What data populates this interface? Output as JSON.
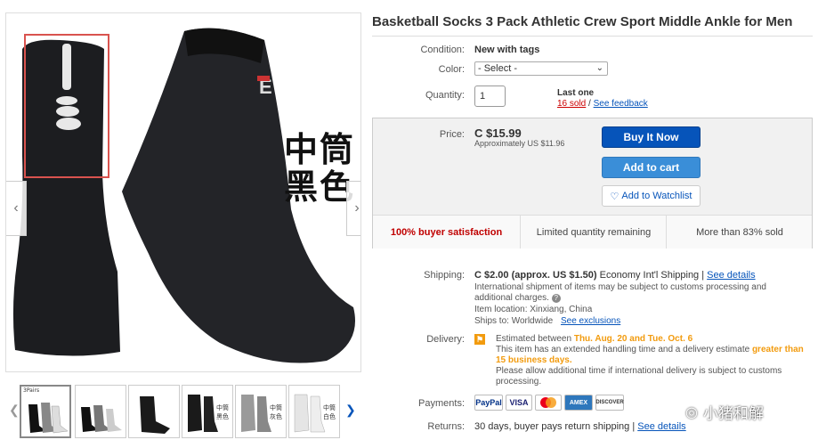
{
  "listing": {
    "title": "Basketball Socks 3 Pack Athletic Crew Sport Middle Ankle for Men",
    "gallery_overlay_text_line1": "中筒",
    "gallery_overlay_text_line2": "黑色",
    "thumbnail_labels": [
      "3Pairs",
      "中筒\n黑色",
      "中筒\n灰色",
      "中筒\n白色"
    ]
  },
  "details": {
    "condition_label": "Condition:",
    "condition_value": "New with tags",
    "color_label": "Color:",
    "color_select": "- Select -",
    "quantity_label": "Quantity:",
    "quantity_value": "1",
    "last_one": "Last one",
    "sold_link": "16 sold",
    "slash": "/",
    "feedback_link": "See feedback"
  },
  "price": {
    "label": "Price:",
    "value": "C $15.99",
    "approx": "Approximately US $11.96",
    "buy_now": "Buy It Now",
    "add_to_cart": "Add to cart",
    "add_to_watchlist": "Add to Watchlist",
    "satisfaction": "100% buyer satisfaction",
    "limited": "Limited quantity remaining",
    "sold_pct": "More than 83% sold"
  },
  "shipping": {
    "label": "Shipping:",
    "cost": "C $2.00 (approx. US $1.50)",
    "method": "Economy Int'l Shipping |",
    "see_details": "See details",
    "note": "International shipment of items may be subject to customs processing and additional charges.",
    "help_icon": "?",
    "item_location": "Item location:  Xinxiang, China",
    "ships_to": "Ships to:  Worldwide",
    "see_exclusions": "See exclusions"
  },
  "delivery": {
    "label": "Delivery:",
    "estimated_prefix": "Estimated between",
    "dates": "Thu. Aug. 20 and Tue. Oct. 6",
    "line2_prefix": "This item has an extended handling time and a delivery estimate",
    "line2_highlight": "greater than 15 business days.",
    "line3": "Please allow additional time if international delivery is subject to customs processing."
  },
  "payments": {
    "label": "Payments:",
    "methods": [
      "PayPal",
      "VISA",
      "MasterCard",
      "AMEX",
      "DISCOVER"
    ]
  },
  "returns": {
    "label": "Returns:",
    "text": "30 days, buyer pays return shipping |",
    "see_details": "See details"
  },
  "watermark": {
    "text": "小猪和解"
  },
  "colors": {
    "accent": "#0654ba",
    "cart": "#3a8ed8",
    "alert": "#c00000",
    "orange": "#f29b0e"
  }
}
